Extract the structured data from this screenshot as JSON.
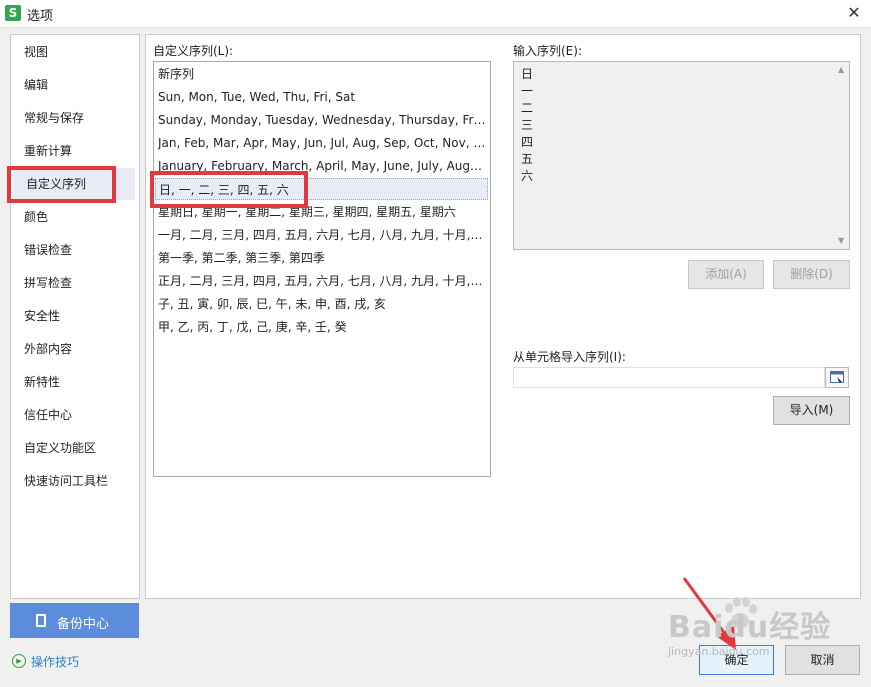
{
  "window": {
    "title": "选项",
    "app_icon_letter": "S"
  },
  "sidebar": {
    "items": [
      {
        "label": "视图"
      },
      {
        "label": "编辑"
      },
      {
        "label": "常规与保存"
      },
      {
        "label": "重新计算"
      },
      {
        "label": "自定义序列",
        "selected": true
      },
      {
        "label": "颜色"
      },
      {
        "label": "错误检查"
      },
      {
        "label": "拼写检查"
      },
      {
        "label": "安全性"
      },
      {
        "label": "外部内容"
      },
      {
        "label": "新特性"
      },
      {
        "label": "信任中心"
      },
      {
        "label": "自定义功能区"
      },
      {
        "label": "快速访问工具栏"
      }
    ],
    "backup_label": "备份中心",
    "tips_label": "操作技巧"
  },
  "custom_lists": {
    "label": "自定义序列(L):",
    "rows": [
      "新序列",
      "Sun, Mon, Tue, Wed, Thu, Fri, Sat",
      "Sunday, Monday, Tuesday, Wednesday, Thursday, Friday, Saturday",
      "Jan, Feb, Mar, Apr, May, Jun, Jul, Aug, Sep, Oct, Nov, Dec",
      "January, February, March, April, May, June, July, August, September, October, November, December",
      "日, 一, 二, 三, 四, 五, 六",
      "星期日, 星期一, 星期二, 星期三, 星期四, 星期五, 星期六",
      "一月, 二月, 三月, 四月, 五月, 六月, 七月, 八月, 九月, 十月, 十一月, 十二月",
      "第一季, 第二季, 第三季, 第四季",
      "正月, 二月, 三月, 四月, 五月, 六月, 七月, 八月, 九月, 十月, 十一月, 腊月",
      "子, 丑, 寅, 卯, 辰, 巳, 午, 未, 申, 酉, 戌, 亥",
      "甲, 乙, 丙, 丁, 戊, 己, 庚, 辛, 壬, 癸"
    ],
    "selected_index": 5
  },
  "entries": {
    "label": "输入序列(E):",
    "lines": [
      "日",
      "一",
      "二",
      "三",
      "四",
      "五",
      "六"
    ]
  },
  "buttons": {
    "add": "添加(A)",
    "delete": "删除(D)",
    "import": "导入(M)",
    "ok": "确定",
    "cancel": "取消"
  },
  "import": {
    "label": "从单元格导入序列(I):",
    "value": ""
  },
  "watermark": {
    "text": "Baidu经验",
    "sub": "jingyan.baidu.com"
  },
  "colors": {
    "highlight": "#e3383d",
    "selection": "#e7ecf6",
    "backup_bg": "#5b8ddc"
  }
}
